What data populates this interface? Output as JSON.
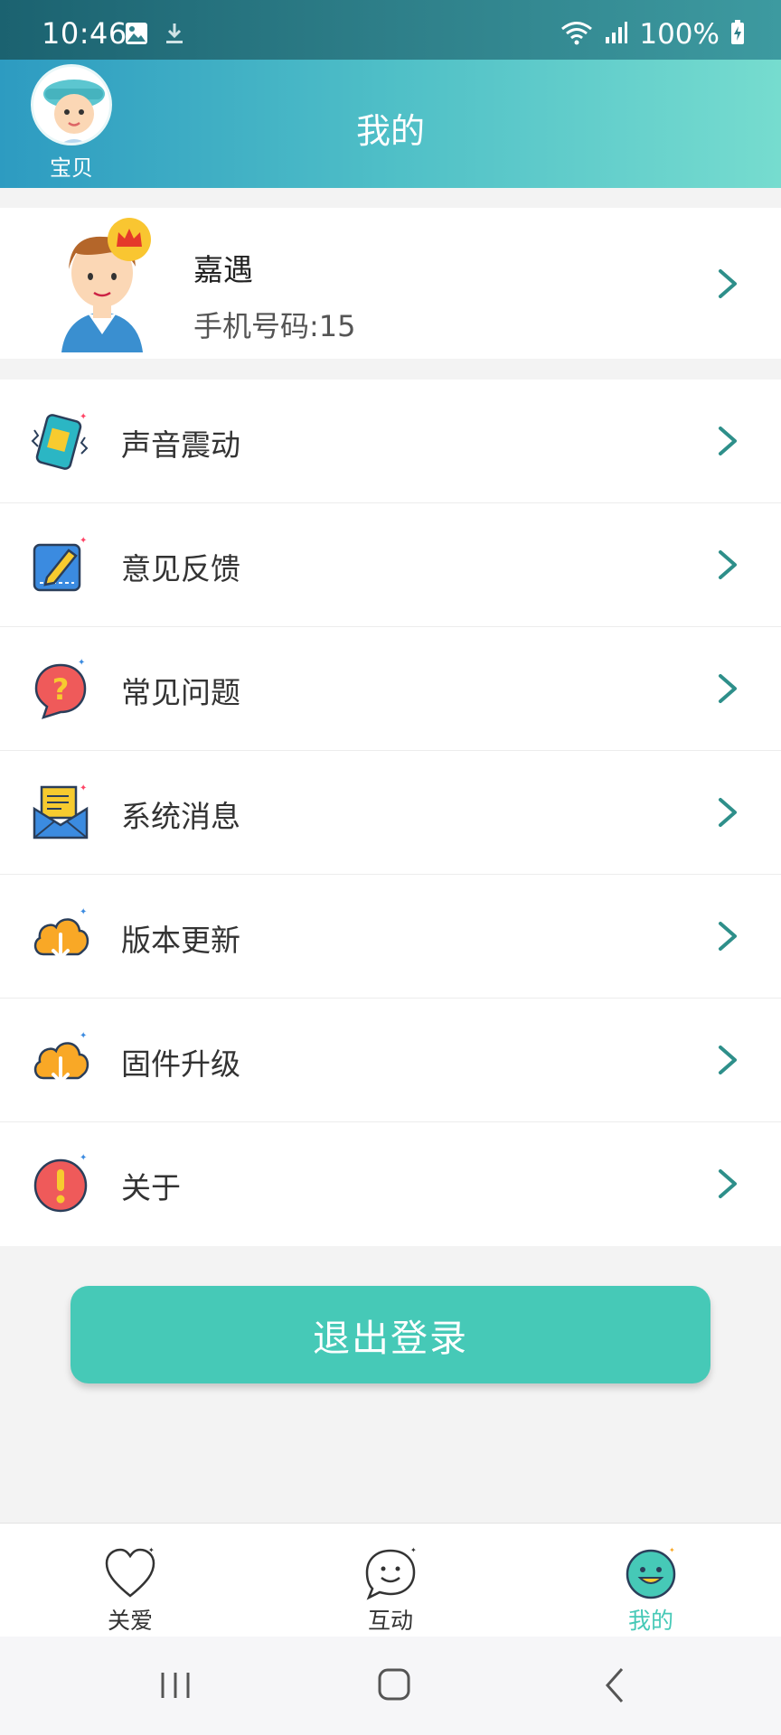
{
  "status_bar": {
    "time": "10:46",
    "battery_percent": "100%",
    "icons": [
      "image-icon",
      "download-icon",
      "wifi-icon",
      "signal-icon",
      "battery-charging-icon"
    ]
  },
  "header": {
    "title": "我的",
    "baby_label": "宝贝"
  },
  "profile": {
    "name": "嘉遇",
    "phone": "手机号码:15"
  },
  "menu": {
    "items": [
      {
        "label": "声音震动",
        "icon": "phone-vibrate-icon"
      },
      {
        "label": "意见反馈",
        "icon": "feedback-pencil-icon"
      },
      {
        "label": "常见问题",
        "icon": "question-bubble-icon"
      },
      {
        "label": "系统消息",
        "icon": "mail-envelope-icon"
      },
      {
        "label": "版本更新",
        "icon": "cloud-download-icon"
      },
      {
        "label": "固件升级",
        "icon": "cloud-download-icon"
      },
      {
        "label": "关于",
        "icon": "exclamation-bubble-icon"
      }
    ]
  },
  "logout": {
    "label": "退出登录"
  },
  "tabs": [
    {
      "label": "关爱",
      "icon": "heart-icon",
      "active": false
    },
    {
      "label": "互动",
      "icon": "chat-smile-icon",
      "active": false
    },
    {
      "label": "我的",
      "icon": "smiley-face-icon",
      "active": true
    }
  ],
  "colors": {
    "accent": "#46c9b7",
    "header_start": "#2d9bc1",
    "header_end": "#76dccf",
    "chevron": "#2e8f8a"
  }
}
